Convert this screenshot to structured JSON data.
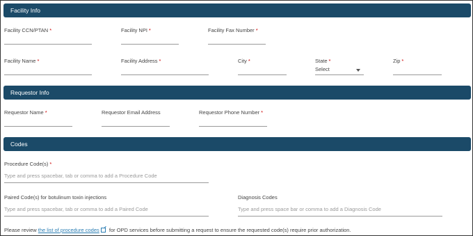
{
  "sections": {
    "facility": "Facility Info",
    "requestor": "Requestor Info",
    "codes": "Codes"
  },
  "facility": {
    "ccn": "Facility CCN/PTAN",
    "npi": "Facility NPI",
    "fax": "Facility Fax Number",
    "name": "Facility Name",
    "address": "Facility Address",
    "city": "City",
    "state": "State",
    "state_value": "Select",
    "zip": "Zip"
  },
  "requestor": {
    "name": "Requestor Name",
    "email": "Requestor Email Address",
    "phone": "Requestor Phone Number"
  },
  "codes": {
    "procedure_label": "Procedure Code(s)",
    "procedure_placeholder": "Type and press spacebar, tab or comma to add a Procedure Code",
    "paired_label": "Paired Code(s) for botulinum toxin injections",
    "paired_placeholder": "Type and press spacebar, tab or comma to add a Paired Code",
    "diagnosis_label": "Diagnosis Codes",
    "diagnosis_placeholder": "Type and press space bar or comma to add a Diagnosis Code"
  },
  "footer": {
    "prefix": "Please review",
    "link": "the list of procedure codes",
    "suffix": "for OPD services before submitting a request to ensure the requested code(s) require prior authorization."
  },
  "required_marker": "*"
}
